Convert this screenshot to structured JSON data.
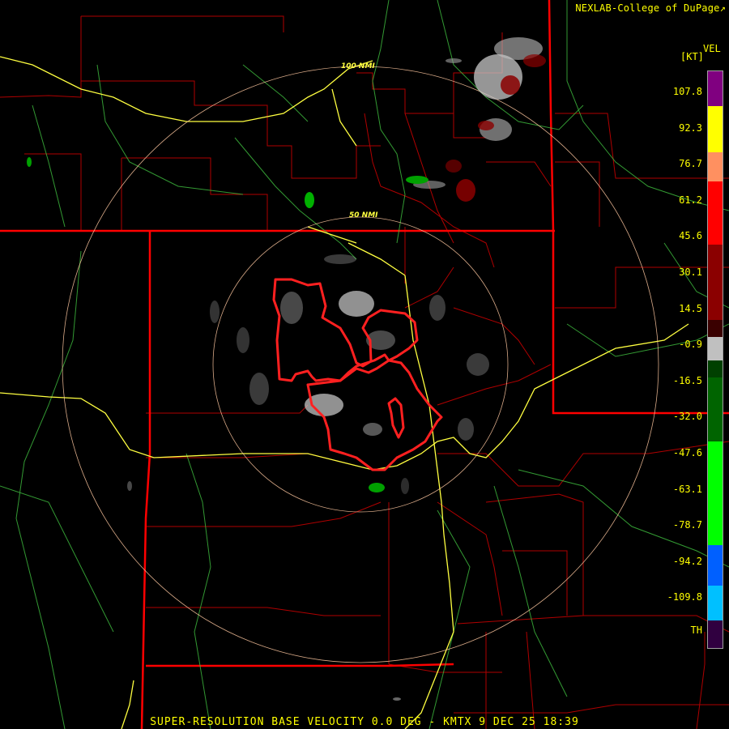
{
  "header": {
    "credit": "NEXLAB-College of DuPage",
    "credit_icon": "external-link-icon"
  },
  "footer": {
    "title": "SUPER-RESOLUTION BASE VELOCITY 0.0 DEG - KMTX 9 DEC 25 18:39"
  },
  "range_rings": {
    "inner_label": "50 NMI",
    "outer_label": "100 NMI"
  },
  "legend": {
    "product": "VEL",
    "unit": "[KT]",
    "labels": [
      "107.8",
      "92.3",
      "76.7",
      "61.2",
      "45.6",
      "30.1",
      "14.5",
      "-0.9",
      "-16.5",
      "-32.0",
      "-47.6",
      "-63.1",
      "-78.7",
      "-94.2",
      "-109.8",
      "TH"
    ],
    "bands": [
      {
        "color": "#800080",
        "from": 0,
        "to": 0.06
      },
      {
        "color": "#ffff00",
        "from": 0.06,
        "to": 0.14
      },
      {
        "color": "#ff9060",
        "from": 0.14,
        "to": 0.19
      },
      {
        "color": "#ff0000",
        "from": 0.19,
        "to": 0.3
      },
      {
        "color": "#8b0000",
        "from": 0.3,
        "to": 0.43
      },
      {
        "color": "#3a0000",
        "from": 0.43,
        "to": 0.46
      },
      {
        "color": "#c0c0c0",
        "from": 0.46,
        "to": 0.5
      },
      {
        "color": "#004000",
        "from": 0.5,
        "to": 0.53
      },
      {
        "color": "#006400",
        "from": 0.53,
        "to": 0.64
      },
      {
        "color": "#00ff00",
        "from": 0.64,
        "to": 0.82
      },
      {
        "color": "#0060ff",
        "from": 0.82,
        "to": 0.89
      },
      {
        "color": "#00c0ff",
        "from": 0.89,
        "to": 0.95
      },
      {
        "color": "#300040",
        "from": 0.95,
        "to": 1
      }
    ]
  },
  "colors": {
    "state_lines": "#ff0000",
    "county_lines": "#b00000",
    "highways": "#ffff40",
    "roads": "#40c040",
    "range_rings": "#ffc8a0",
    "warning_polygon": "#ff2020"
  }
}
